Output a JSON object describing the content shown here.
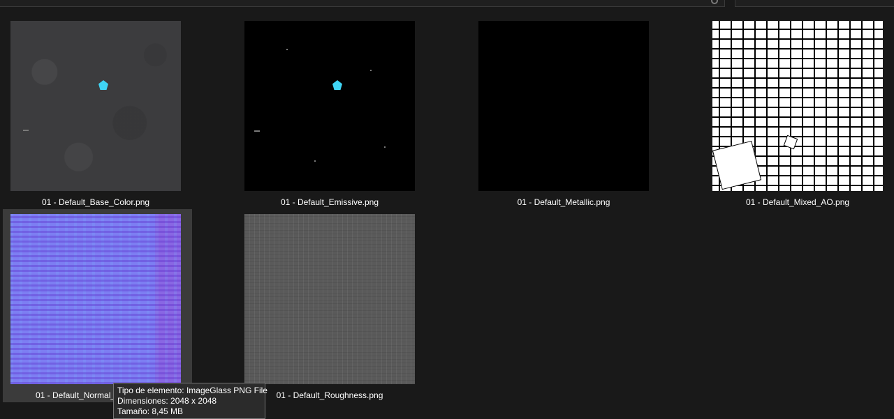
{
  "files": [
    {
      "name": "01 - Default_Base_Color.png",
      "texture": "base"
    },
    {
      "name": "01 - Default_Emissive.png",
      "texture": "emissive"
    },
    {
      "name": "01 - Default_Metallic.png",
      "texture": "metallic"
    },
    {
      "name": "01 - Default_Mixed_AO.png",
      "texture": "ao"
    },
    {
      "name": "01 - Default_Normal_",
      "texture": "normal",
      "selected": true
    },
    {
      "name": "01 - Default_Roughness.png",
      "texture": "roughness"
    }
  ],
  "tooltip": {
    "type_line": "Tipo de elemento: ImageGlass PNG File",
    "dimensions_line": "Dimensiones: 2048 x 2048",
    "size_line": "Tamaño: 8,45 MB"
  },
  "colors": {
    "background": "#191919",
    "selection": "#3b3b3b",
    "gem": "#3fd5f5",
    "normal_map": "#7d7ef2"
  }
}
